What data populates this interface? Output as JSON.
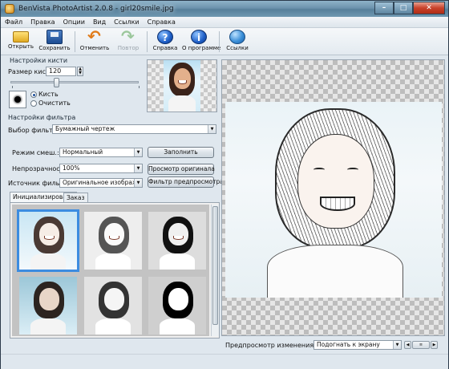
{
  "window": {
    "title": "BenVista PhotoArtist 2.0.8 - girl20smile.jpg",
    "controls": {
      "minimize": "–",
      "maximize": "□",
      "close": "✕"
    }
  },
  "menu": [
    "Файл",
    "Правка",
    "Опции",
    "Вид",
    "Ссылки",
    "Справка"
  ],
  "toolbar": {
    "open": "Открыть",
    "save": "Сохранить",
    "undo": "Отменить",
    "redo": "Повтор",
    "help": "Справка",
    "about": "О программе",
    "links": "Ссылки",
    "help_glyph": "?",
    "about_glyph": "i"
  },
  "brush": {
    "section_title": "Настройки кисти",
    "size_label": "Размер кисти:",
    "size_value": "120",
    "size_slider_fraction": 0.28,
    "mode_brush": "Кисть",
    "mode_clear": "Очистить",
    "selected_mode": "brush"
  },
  "filter": {
    "section_title": "Настройки фильтра",
    "select_label": "Выбор фильтра:",
    "select_value": "Бумажный чертеж",
    "blend_label": "Режим смеш.:",
    "blend_value": "Нормальный",
    "opacity_label": "Непрозрачность:",
    "opacity_value": "100%",
    "source_label": "Источник фильтра:",
    "source_value": "Оригинальное изображение",
    "fill_button": "Заполнить",
    "view_original_button": "Просмотр оригинала",
    "preview_filter_button": "Фильтр предпросмотра"
  },
  "tabs": {
    "initialize": "Инициализировать",
    "order": "Заказ",
    "active": "initialize"
  },
  "preview": {
    "zoom_label": "Предпросмотр изменения масштаба:",
    "zoom_value": "Подогнать к экрану"
  },
  "colors": {
    "selection": "#3c8ce0",
    "titlebar": "#6c93ad"
  }
}
